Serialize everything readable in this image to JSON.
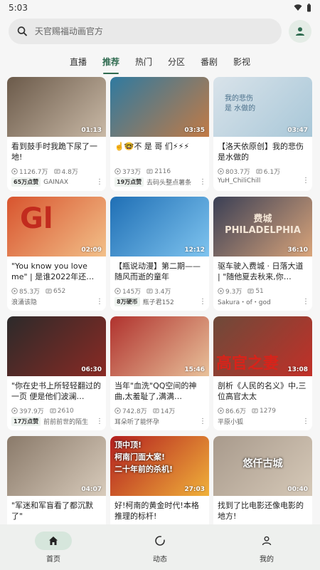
{
  "status": {
    "time": "5:03"
  },
  "search": {
    "placeholder": "天官赐福动画官方"
  },
  "tabs": [
    {
      "label": "直播"
    },
    {
      "label": "推荐"
    },
    {
      "label": "热门"
    },
    {
      "label": "分区"
    },
    {
      "label": "番剧"
    },
    {
      "label": "影视"
    }
  ],
  "videos": [
    {
      "title": "看到鼓手时我跪下尿了一地!",
      "duration": "01:13",
      "views": "1126.7万",
      "comments": "4.8万",
      "badge": "65万点赞",
      "author": "GAINAX",
      "thumb": "#6b5a4a",
      "thumb2": "#c9b9a6"
    },
    {
      "title": "☝️🤓不 是 哥 们⚡⚡⚡",
      "duration": "03:35",
      "views": "373万",
      "comments": "2116",
      "badge": "19万点赞",
      "author": "去码头整点薯条",
      "thumb": "#2f7aa0",
      "thumb2": "#c27a45"
    },
    {
      "title": "【洛天依原创】我的悲伤是水做的",
      "duration": "03:47",
      "views": "803.7万",
      "comments": "6.1万",
      "badge": "",
      "author": "YuH_ChiliChill",
      "thumb": "#d9e3ea",
      "thumb2": "#a8c7d8"
    },
    {
      "title": "\"You know you love me\" | 是谁2022年还…",
      "duration": "02:09",
      "views": "85.3万",
      "comments": "652",
      "badge": "",
      "author": "浪涌该隐",
      "thumb": "#d8542e",
      "thumb2": "#f2c089"
    },
    {
      "title": "【瓶说动漫】第二期——随风而逝的童年",
      "duration": "12:12",
      "views": "145万",
      "comments": "3.4万",
      "badge": "8万硬币",
      "author": "瓶子君152",
      "thumb": "#1f6fb5",
      "thumb2": "#7fc4ef"
    },
    {
      "title": "驱车驶入费城 · 日落大道 | \"随他夏去秋来,你…",
      "duration": "36:10",
      "views": "9.3万",
      "comments": "51",
      "badge": "",
      "author": "Sakura・of・god",
      "thumb": "#3a3f55",
      "thumb2": "#d9a47a"
    },
    {
      "title": "\"你在史书上所轻轻翻过的一页 便是他们波澜…",
      "duration": "06:30",
      "views": "397.9万",
      "comments": "2610",
      "badge": "17万点赞",
      "author": "前前前世的陌生",
      "thumb": "#2c2a2a",
      "thumb2": "#8a2a24"
    },
    {
      "title": "当年\"血洗\"QQ空间的神曲,太羞耻了,满满…",
      "duration": "15:46",
      "views": "742.8万",
      "comments": "14万",
      "badge": "",
      "author": "耳朵听了能怀孕",
      "thumb": "#b0322e",
      "thumb2": "#e8c19a"
    },
    {
      "title": "剖析《人民的名义》中,三位高官太太",
      "duration": "13:08",
      "views": "86.6万",
      "comments": "1279",
      "badge": "",
      "author": "平原小狐",
      "thumb": "#6d4a3a",
      "thumb2": "#c23028"
    },
    {
      "title": "\"军迷和军盲看了都沉默了\"",
      "duration": "04:07",
      "views": "",
      "comments": "",
      "badge": "",
      "author": "",
      "thumb": "#8a7a6a",
      "thumb2": "#d8cbbb"
    },
    {
      "title": "好!柯南的黄金时代!本格推理的标杆!",
      "duration": "27:03",
      "views": "",
      "comments": "",
      "badge": "",
      "author": "",
      "thumb": "#b31f1f",
      "thumb2": "#f0b13a"
    },
    {
      "title": "找到了比电影还像电影的地方!",
      "duration": "00:40",
      "views": "",
      "comments": "",
      "badge": "",
      "author": "",
      "thumb": "#a89a8c",
      "thumb2": "#d6c9b8"
    }
  ],
  "thumb_texts": {
    "v3_line1": "我的悲伤",
    "v3_line2": "是 水做的",
    "v4_overlay": "Gl",
    "v6_line1": "费城",
    "v6_line2": "PHILADELPHIA",
    "v9_overlay": "高官之妻",
    "v11_line1": "顶中顶!",
    "v11_line2": "柯南门面大案!",
    "v11_line3": "二十年前的杀机!",
    "v12_overlay": "悠仟古城"
  },
  "bottom_nav": [
    {
      "label": "首页"
    },
    {
      "label": "动态"
    },
    {
      "label": "我的"
    }
  ],
  "colors": {
    "accent": "#2f6b50",
    "nav_active_bg": "#d6e6dc"
  }
}
